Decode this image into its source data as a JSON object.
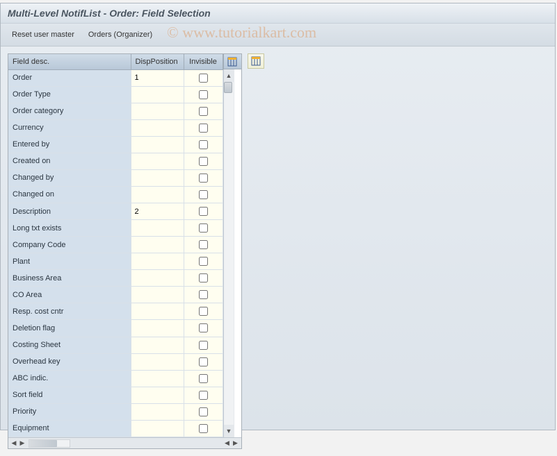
{
  "window": {
    "title": "Multi-Level NotifList - Order: Field Selection"
  },
  "toolbar": {
    "reset_label": "Reset user master",
    "orders_label": "Orders (Organizer)"
  },
  "table": {
    "headers": {
      "field_desc": "Field desc.",
      "disp_position": "DispPosition",
      "invisible": "Invisible"
    },
    "rows": [
      {
        "desc": "Order",
        "pos": "1",
        "inv": false
      },
      {
        "desc": "Order Type",
        "pos": "",
        "inv": false
      },
      {
        "desc": "Order category",
        "pos": "",
        "inv": false
      },
      {
        "desc": "Currency",
        "pos": "",
        "inv": false
      },
      {
        "desc": "Entered by",
        "pos": "",
        "inv": false
      },
      {
        "desc": "Created on",
        "pos": "",
        "inv": false
      },
      {
        "desc": "Changed by",
        "pos": "",
        "inv": false
      },
      {
        "desc": "Changed on",
        "pos": "",
        "inv": false
      },
      {
        "desc": "Description",
        "pos": "2",
        "inv": false
      },
      {
        "desc": "Long txt exists",
        "pos": "",
        "inv": false
      },
      {
        "desc": "Company Code",
        "pos": "",
        "inv": false
      },
      {
        "desc": "Plant",
        "pos": "",
        "inv": false
      },
      {
        "desc": "Business Area",
        "pos": "",
        "inv": false
      },
      {
        "desc": "CO Area",
        "pos": "",
        "inv": false
      },
      {
        "desc": "Resp. cost cntr",
        "pos": "",
        "inv": false
      },
      {
        "desc": "Deletion flag",
        "pos": "",
        "inv": false
      },
      {
        "desc": "Costing Sheet",
        "pos": "",
        "inv": false
      },
      {
        "desc": "Overhead key",
        "pos": "",
        "inv": false
      },
      {
        "desc": "ABC indic.",
        "pos": "",
        "inv": false
      },
      {
        "desc": "Sort field",
        "pos": "",
        "inv": false
      },
      {
        "desc": "Priority",
        "pos": "",
        "inv": false
      },
      {
        "desc": "Equipment",
        "pos": "",
        "inv": false
      }
    ]
  },
  "watermark": "© www.tutorialkart.com"
}
